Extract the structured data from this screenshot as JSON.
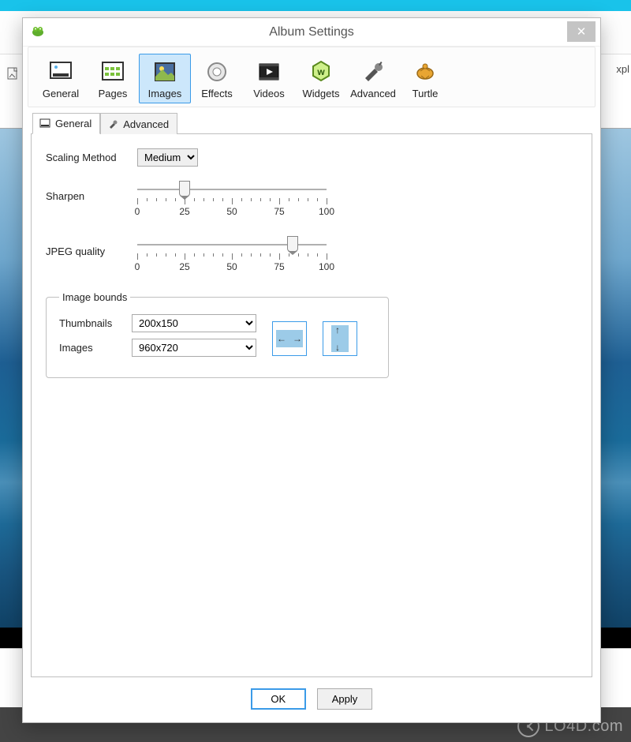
{
  "bg": {
    "right_text": "xpl"
  },
  "dialog_title": "Album Settings",
  "toolbar": {
    "items": [
      {
        "label": "General"
      },
      {
        "label": "Pages"
      },
      {
        "label": "Images"
      },
      {
        "label": "Effects"
      },
      {
        "label": "Videos"
      },
      {
        "label": "Widgets"
      },
      {
        "label": "Advanced"
      },
      {
        "label": "Turtle"
      }
    ],
    "selected_index": 2
  },
  "subtabs": {
    "general": "General",
    "advanced": "Advanced",
    "active": "general"
  },
  "form": {
    "scaling_label": "Scaling Method",
    "scaling_value": "Medium",
    "sharpen": {
      "label": "Sharpen",
      "min": 0,
      "max": 100,
      "value": 25,
      "ticks": [
        0,
        25,
        50,
        75,
        100
      ]
    },
    "jpeg": {
      "label": "JPEG quality",
      "min": 0,
      "max": 100,
      "value": 82,
      "ticks": [
        0,
        25,
        50,
        75,
        100
      ]
    },
    "bounds": {
      "legend": "Image bounds",
      "thumbnails_label": "Thumbnails",
      "thumbnails_value": "200x150",
      "images_label": "Images",
      "images_value": "960x720"
    }
  },
  "buttons": {
    "ok": "OK",
    "apply": "Apply"
  },
  "watermark": "LO4D.com"
}
